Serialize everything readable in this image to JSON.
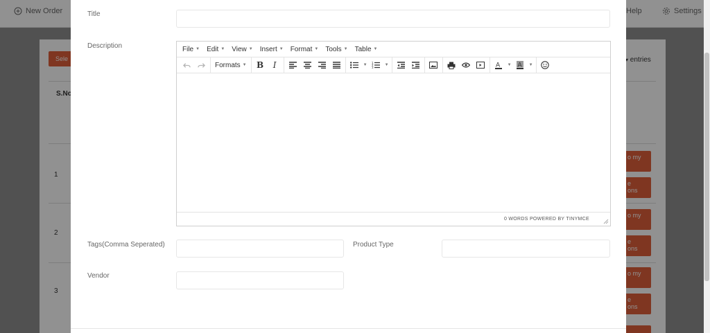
{
  "background": {
    "topbar": {
      "new_order": "New Order",
      "help": "Help",
      "settings": "Settings"
    },
    "select_button": "Sele",
    "entries_label": "entries",
    "table_header_sno": "S.No",
    "row_numbers": [
      "1",
      "2",
      "3"
    ],
    "row_button_fragments": [
      "o my",
      "e",
      "ons"
    ]
  },
  "form": {
    "title_label": "Title",
    "title_value": "",
    "description_label": "Description",
    "tags_label": "Tags(Comma Seperated)",
    "tags_value": "",
    "product_type_label": "Product Type",
    "product_type_value": "",
    "vendor_label": "Vendor",
    "vendor_value": ""
  },
  "editor": {
    "menus": [
      "File",
      "Edit",
      "View",
      "Insert",
      "Format",
      "Tools",
      "Table"
    ],
    "formats_label": "Formats",
    "status_text": "0 WORDS POWERED BY TINYMCE",
    "icons": [
      "undo-icon",
      "redo-icon",
      "bold-icon",
      "italic-icon",
      "align-left-icon",
      "align-center-icon",
      "align-right-icon",
      "align-justify-icon",
      "bullet-list-icon",
      "numbered-list-icon",
      "outdent-icon",
      "indent-icon",
      "image-icon",
      "print-icon",
      "preview-icon",
      "media-icon",
      "text-color-icon",
      "background-color-icon",
      "emoticons-icon"
    ]
  },
  "colors": {
    "accent": "#e0603a",
    "overlay": "rgba(0,0,0,0.43)"
  }
}
